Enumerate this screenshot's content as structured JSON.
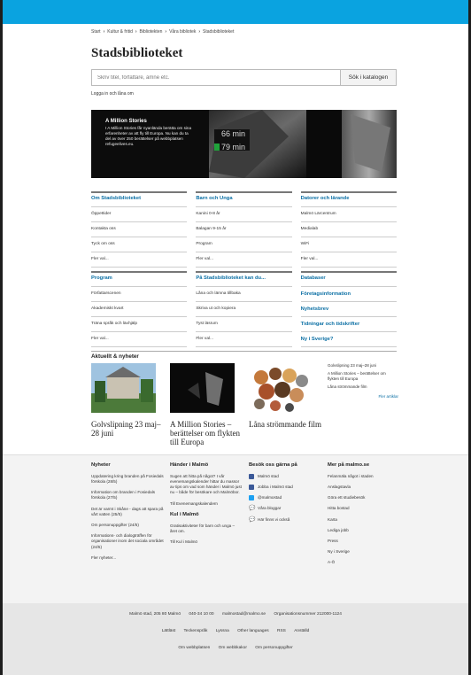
{
  "breadcrumb": [
    "Start",
    "Kultur & fritid",
    "Bibliotekten",
    "Våra bibliotek",
    "Stadsbiblioteket"
  ],
  "page_title": "Stadsbiblioteket",
  "search": {
    "placeholder": "Skriv titel, författare, ämne etc.",
    "button": "Sök i katalogen"
  },
  "login_text": "Logga in och låna om",
  "hero": {
    "title": "A Million Stories",
    "text": "I A Million Stories får nyanlända berätta om sina erfarenheter av att fly till Europa. Nu kan du ta del av över 250 berättelser på webbplatsen refugeelives.eu.",
    "image_text": [
      "66 min",
      "79 min"
    ]
  },
  "columns_top": [
    {
      "title": "Om Stadsbiblioteket",
      "links": [
        "Öppettider",
        "Kontakta oss",
        "Tyck om oss",
        "Fler val..."
      ]
    },
    {
      "title": "Barn och Unga",
      "links": [
        "Kanini 0-8 år",
        "Balagan 9-15 år",
        "Program",
        "Fler val..."
      ]
    },
    {
      "title": "Datorer och lärande",
      "links": [
        "Malmö Lärcentrum",
        "Medialab",
        "WiFi",
        "Fler val..."
      ]
    }
  ],
  "columns_bottom": [
    {
      "title": "Program",
      "links": [
        "Författarscenen",
        "Akademiskt kvart",
        "Träna språk och läxhjälp",
        "Fler val..."
      ]
    },
    {
      "title": "På Stadsbiblioteket kan du...",
      "links": [
        "Låna och lämna tillbaka",
        "Skriva ut och kopiera",
        "Tyst läsrum",
        "Fler val..."
      ]
    },
    {
      "title": "Databaser",
      "heads": [
        "Företagsinformation",
        "Nyhetsbrev",
        "Tidningar och tidskrifter",
        "Ny i Sverige?"
      ]
    }
  ],
  "news": {
    "title": "Aktuellt & nyheter",
    "items": [
      {
        "caption": "Golvslipning 23 maj–28 juni"
      },
      {
        "caption": "A Million Stories – berättelser om flykten till Europa"
      },
      {
        "caption": "Låna strömmande film"
      }
    ],
    "side": [
      "Golvslipning 23 maj–28 juni",
      "A Million Stories – berättelser om flykten till Europa",
      "Låna strömmande film"
    ],
    "more": "Fler artiklar"
  },
  "footer": {
    "nyheter": {
      "title": "Nyheter",
      "items": [
        "Uppdatering kring branden på Fosiedals förskola (28/5)",
        "Information om branden i Fosiedals förskola (27/5)",
        "Det är varmt i Skåne - dags att spara på vårt vatten (25/5)",
        "Om personuppgifter (24/5)",
        "Informations- och dialogträffen för organisationer inom det sociala området (24/5)",
        "Fler nyheter..."
      ]
    },
    "hander": {
      "title": "Händer i Malmö",
      "text": "Sugen att hitta på något? I vår evenemangskalender hittar du massor av tips om vad som händer i Malmö just nu – både för besökare och Malmöbor.",
      "link": "Till Evenemangskalendern",
      "kul_title": "Kul i Malmö",
      "kul_text": "Gratisaktiviteter för barn och unga – året om.",
      "kul_link": "Till Kul i Malmö"
    },
    "besok": {
      "title": "Besök oss gärna på",
      "items": [
        "Malmö stad",
        "Jobba i Malmö stad",
        "@malmostad",
        "Våra bloggar",
        "Här finns vi också"
      ]
    },
    "mer": {
      "title": "Mer på malmo.se",
      "items": [
        "Felanmäla något i staden",
        "Anslagstavla",
        "Göra ett studiebesök",
        "Hitta bostad",
        "Karta",
        "Lediga jobb",
        "Press",
        "Ny i Sverige",
        "A-Ö"
      ]
    }
  },
  "bottom": {
    "row1": [
      "Malmö stad, 205 80 Malmö",
      "040-34 10 00",
      "malmostad@malmo.se",
      "Organisationsnummer 212000-1124"
    ],
    "row2": [
      "Lättläst",
      "Teckenspråk",
      "Lyssna",
      "Other languages",
      "RSS",
      "Anställd"
    ],
    "row3": [
      "Om webbplatsen",
      "Om webbkakor",
      "Om personuppgifter"
    ]
  },
  "colors": {
    "topbar": "#0aa3e0",
    "link": "#0b6fa4",
    "footer_bg": "#f3f3f3"
  }
}
